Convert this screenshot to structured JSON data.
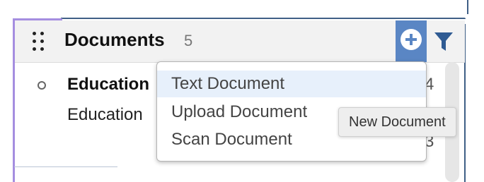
{
  "panel": {
    "title": "Documents",
    "count": "5"
  },
  "list": {
    "item_title": "Education",
    "item_subtitle": "Education",
    "right_value_1": "4",
    "right_value_2": "3"
  },
  "menu": {
    "items": [
      {
        "label": "Text Document"
      },
      {
        "label": "Upload Document"
      },
      {
        "label": "Scan Document"
      }
    ]
  },
  "tooltip": {
    "text": "New Document"
  },
  "icons": {
    "drag": "drag-handle-icon",
    "add": "plus-circle-icon",
    "filter": "filter-icon"
  },
  "colors": {
    "accent": "#5a86c4",
    "sidebar_accent": "#a58ee0",
    "frame": "#3f5f86",
    "menu_highlight": "#e7f0fb"
  }
}
